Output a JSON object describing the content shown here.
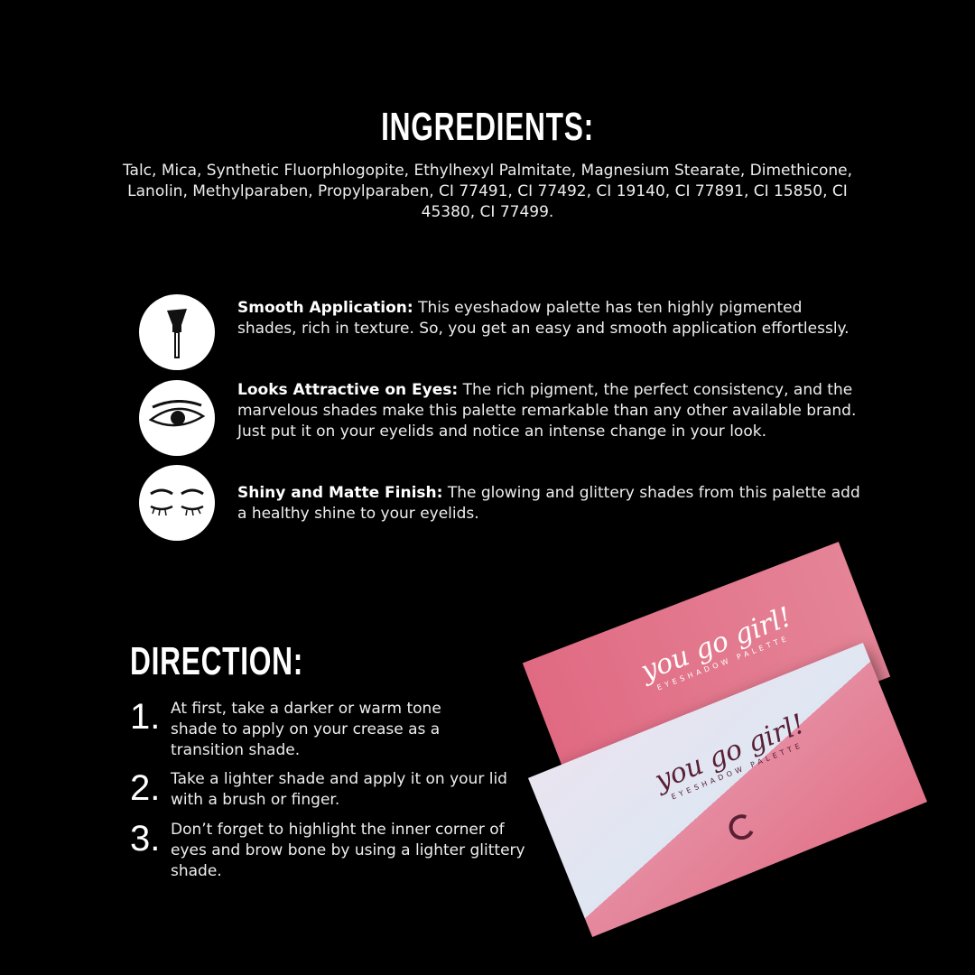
{
  "ingredients": {
    "title": "INGREDIENTS:",
    "text": "Talc, Mica, Synthetic Fluorphlogopite, Ethylhexyl Palmitate, Magnesium Stearate, Dimethicone, Lanolin, Methylparaben, Propylparaben, CI 77491, CI 77492, CI 19140, CI 77891, CI 15850, CI 45380, CI 77499."
  },
  "features": [
    {
      "icon": "makeup-brush-icon",
      "title": "Smooth Application:",
      "text": " This eyeshadow palette has ten highly pigmented shades, rich in texture. So, you get an easy and smooth application effortlessly."
    },
    {
      "icon": "open-eye-icon",
      "title": "Looks Attractive on Eyes:",
      "text": " The rich pigment, the perfect consistency, and the marvelous shades make this palette remarkable than any other available brand. Just put it on your eyelids and notice an intense change in your look."
    },
    {
      "icon": "closed-eyes-icon",
      "title": "Shiny and Matte Finish:",
      "text": " The glowing and glittery shades from this palette add a healthy shine to your eyelids."
    }
  ],
  "direction": {
    "title": "DIRECTION:",
    "steps": [
      {
        "num": "1.",
        "text": "At first, take a darker or warm tone shade to apply on your crease as a transition shade."
      },
      {
        "num": "2.",
        "text": "Take a lighter shade and apply it on your lid with a brush or finger."
      },
      {
        "num": "3.",
        "text": "Don’t forget to highlight the inner corner of eyes and brow bone by using a lighter glittery shade."
      }
    ]
  },
  "product": {
    "script": "you go girl!",
    "subtitle": "EYESHADOW PALETTE",
    "colors": {
      "pink": "#e27388",
      "light": "#e9e4f0",
      "dark": "#5a1f33"
    }
  }
}
